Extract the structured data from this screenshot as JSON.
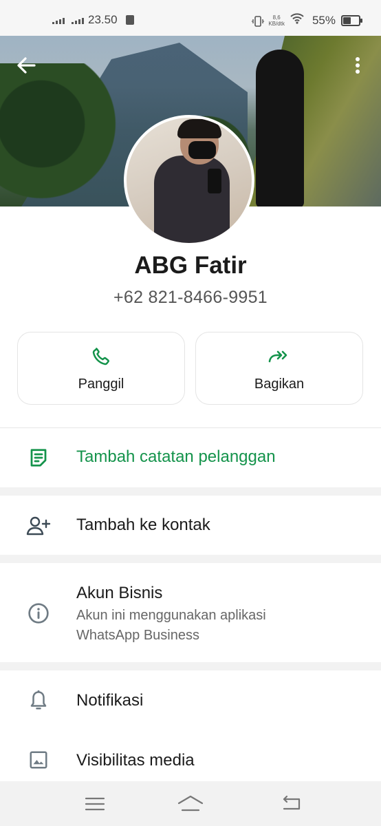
{
  "status_bar": {
    "time": "23.50",
    "network_speed_value": "8,6",
    "network_speed_unit": "KB/dtk",
    "battery": "55%",
    "battery_level": 0.55
  },
  "header": {
    "back_icon": "arrow-left-icon",
    "menu_icon": "more-vert-icon"
  },
  "profile": {
    "name": "ABG Fatir",
    "phone": "+62 821-8466-9951"
  },
  "actions": [
    {
      "label": "Panggil",
      "icon": "phone-icon",
      "color": "#14934b"
    },
    {
      "label": "Bagikan",
      "icon": "share-forward-icon",
      "color": "#14934b"
    }
  ],
  "customer_note": {
    "label": "Tambah catatan pelanggan",
    "icon": "note-icon",
    "color": "#14934b"
  },
  "add_contact": {
    "label": "Tambah ke kontak",
    "icon": "person-add-icon"
  },
  "business": {
    "title": "Akun Bisnis",
    "subtitle_line1": "Akun ini menggunakan aplikasi",
    "subtitle_line2": "WhatsApp Business",
    "icon": "info-icon"
  },
  "settings": [
    {
      "label": "Notifikasi",
      "icon": "bell-icon"
    },
    {
      "label": "Visibilitas media",
      "icon": "image-icon"
    }
  ],
  "navbar": {
    "icons": [
      "menu-icon",
      "home-icon",
      "back-icon"
    ]
  }
}
